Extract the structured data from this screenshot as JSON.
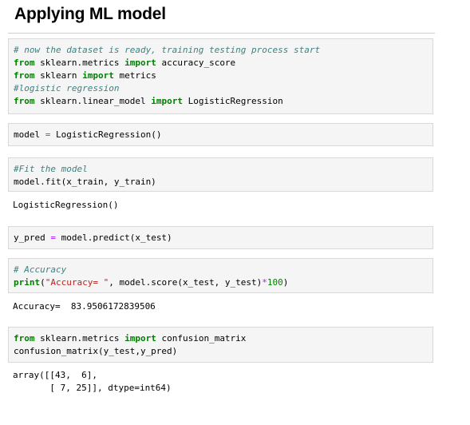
{
  "heading": "Applying ML model",
  "cells": [
    {
      "lines": [
        [
          {
            "t": "# now the dataset is ready, training testing process start",
            "c": "cm"
          }
        ],
        [
          {
            "t": "from",
            "c": "kw"
          },
          {
            "t": " sklearn.metrics "
          },
          {
            "t": "import",
            "c": "kw"
          },
          {
            "t": " accuracy_score"
          }
        ],
        [
          {
            "t": "from",
            "c": "kw"
          },
          {
            "t": " sklearn "
          },
          {
            "t": "import",
            "c": "kw"
          },
          {
            "t": " metrics"
          }
        ],
        [
          {
            "t": "#logistic regression",
            "c": "cm"
          }
        ],
        [
          {
            "t": "from",
            "c": "kw"
          },
          {
            "t": " sklearn.linear_model "
          },
          {
            "t": "import",
            "c": "kw"
          },
          {
            "t": " LogisticRegression"
          }
        ]
      ]
    },
    {
      "lines": [
        [
          {
            "t": "model "
          },
          {
            "t": "=",
            "c": "op"
          },
          {
            "t": " LogisticRegression()"
          }
        ]
      ]
    },
    {
      "lines": [
        [
          {
            "t": "#Fit the model",
            "c": "cm"
          }
        ],
        [
          {
            "t": "model.fit(x_train, y_train)"
          }
        ]
      ],
      "output": [
        "LogisticRegression()"
      ]
    },
    {
      "lines": [
        [
          {
            "t": "y_pred "
          },
          {
            "t": "=",
            "c": "op"
          },
          {
            "t": " model.predict(x_test)"
          }
        ]
      ]
    },
    {
      "lines": [
        [
          {
            "t": "# Accuracy",
            "c": "cm"
          }
        ],
        [
          {
            "t": "print",
            "c": "kw"
          },
          {
            "t": "("
          },
          {
            "t": "\"Accuracy= \"",
            "c": "str"
          },
          {
            "t": ", model.score(x_test, y_test)"
          },
          {
            "t": "*",
            "c": "op"
          },
          {
            "t": "100",
            "c": "num"
          },
          {
            "t": ")"
          }
        ]
      ],
      "output": [
        "Accuracy=  83.9506172839506"
      ]
    },
    {
      "lines": [
        [
          {
            "t": "from",
            "c": "kw"
          },
          {
            "t": " sklearn.metrics "
          },
          {
            "t": "import",
            "c": "kw"
          },
          {
            "t": " confusion_matrix"
          }
        ],
        [
          {
            "t": "confusion_matrix(y_test,y_pred)"
          }
        ]
      ],
      "output": [
        "array([[43,  6],",
        "       [ 7, 25]], dtype=int64)"
      ]
    }
  ]
}
